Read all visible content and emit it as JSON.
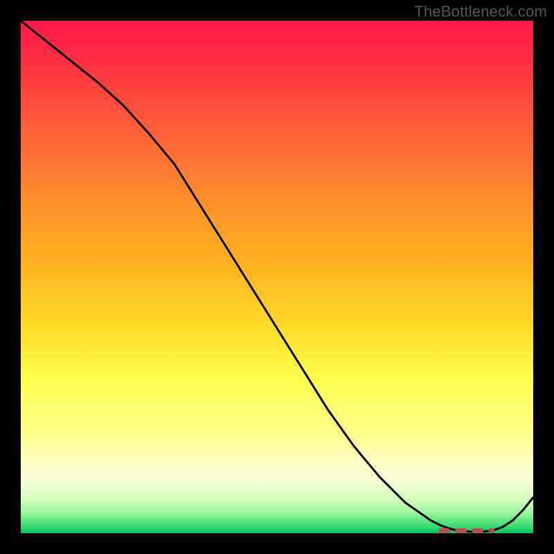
{
  "watermark": "TheBottleneck.com",
  "chart_data": {
    "type": "line",
    "title": "",
    "xlabel": "",
    "ylabel": "",
    "xlim": [
      0,
      100
    ],
    "ylim": [
      0,
      100
    ],
    "grid": false,
    "legend": false,
    "series": [
      {
        "name": "bottleneck-curve",
        "x": [
          0,
          5,
          10,
          15,
          20,
          25,
          30,
          35,
          40,
          45,
          50,
          55,
          60,
          65,
          70,
          75,
          80,
          82,
          84,
          86,
          88,
          90,
          92,
          94,
          96,
          98,
          100
        ],
        "values": [
          100,
          96,
          92,
          88,
          83.5,
          78,
          72,
          64,
          56,
          48,
          40,
          32,
          24,
          17,
          11,
          6,
          2.5,
          1.5,
          0.8,
          0.4,
          0.3,
          0.3,
          0.5,
          1.2,
          2.5,
          4.5,
          7
        ]
      }
    ],
    "annotations": [
      {
        "name": "optimal-region-marker",
        "x_range": [
          82,
          92
        ],
        "y": 0.5
      }
    ],
    "background_gradient": {
      "top": "#ff1a4a",
      "mid": "#ffff4d",
      "bottom": "#00c060"
    }
  }
}
